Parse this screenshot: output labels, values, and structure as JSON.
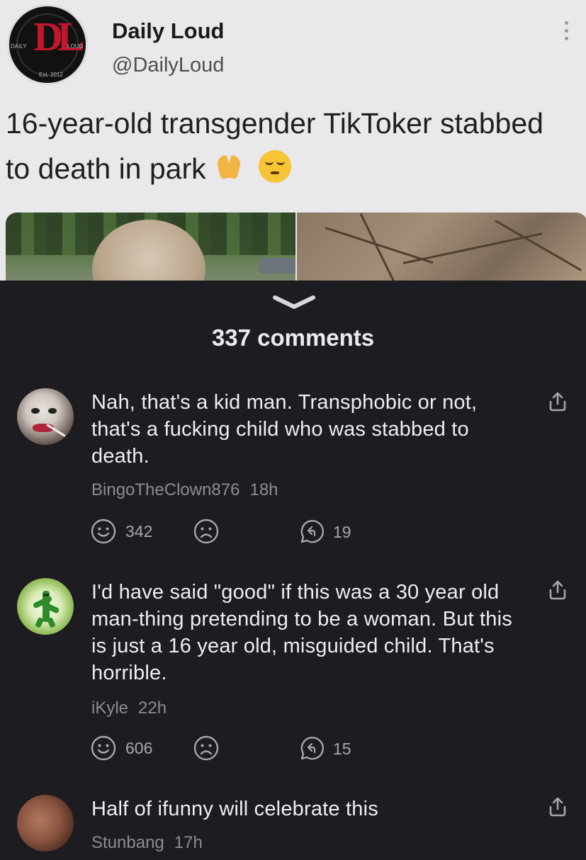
{
  "tweet": {
    "display_name": "Daily Loud",
    "handle": "@DailyLoud",
    "text": "16-year-old transgender TikToker stabbed to death in park",
    "emojis": [
      "folded-hands-emoji",
      "pensive-face-emoji"
    ],
    "logo": {
      "monogram": "DL",
      "left_word": "DAILY",
      "right_word": "LOUD",
      "est": "Est. 2012",
      "brand_color": "#c0172c"
    }
  },
  "comments_header": {
    "count_label": "337 comments"
  },
  "comments": [
    {
      "text": "Nah, that's a kid man. Transphobic or not, that's a fucking child who was stabbed to death.",
      "username": "BingoTheClown876",
      "time": "18h",
      "likes": "342",
      "replies": "19"
    },
    {
      "text": "I'd have said \"good\" if this was a 30 year old man-thing pretending to be a woman. But this is just a 16 year old, misguided child. That's horrible.",
      "username": "iKyle",
      "time": "22h",
      "likes": "606",
      "replies": "15"
    },
    {
      "text": "Half of ifunny will celebrate this",
      "username": "Stunbang",
      "time": "17h"
    }
  ],
  "colors": {
    "sheet_bg": "#1c1c21",
    "text": "#eeedf2",
    "meta": "#8d8c94",
    "icons": "#a7a6ad",
    "tweet_bg": "#e9e8ea"
  }
}
